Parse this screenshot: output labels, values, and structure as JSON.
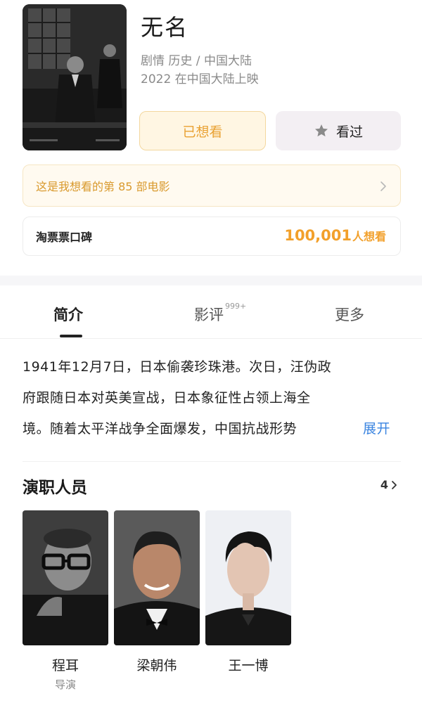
{
  "movie": {
    "title": "无名",
    "genres_region": "剧情 历史 / 中国大陆",
    "release": "2022 在中国大陆上映"
  },
  "actions": {
    "want_label": "已想看",
    "watched_label": "看过",
    "watched_icon": "star-icon"
  },
  "tip": {
    "text": "这是我想看的第 85 部电影"
  },
  "rating": {
    "label": "淘票票口碑",
    "count": "100,001",
    "unit": "人想看"
  },
  "tabs": {
    "intro": "简介",
    "review": "影评",
    "review_badge": "999+",
    "more": "更多"
  },
  "synopsis": {
    "line1": "1941年12月7日，日本偷袭珍珠港。次日，汪伪政",
    "line2": "府跟随日本对英美宣战，日本象征性占领上海全",
    "line3": "境。随着太平洋战争全面爆发，中国抗战形势",
    "expand": "展开"
  },
  "cast": {
    "title": "演职人员",
    "count": "4",
    "members": [
      {
        "name": "程耳",
        "role": "导演"
      },
      {
        "name": "梁朝伟",
        "role": ""
      },
      {
        "name": "王一博",
        "role": ""
      }
    ]
  },
  "colors": {
    "accent": "#f2a02b",
    "link": "#3a84e0"
  }
}
